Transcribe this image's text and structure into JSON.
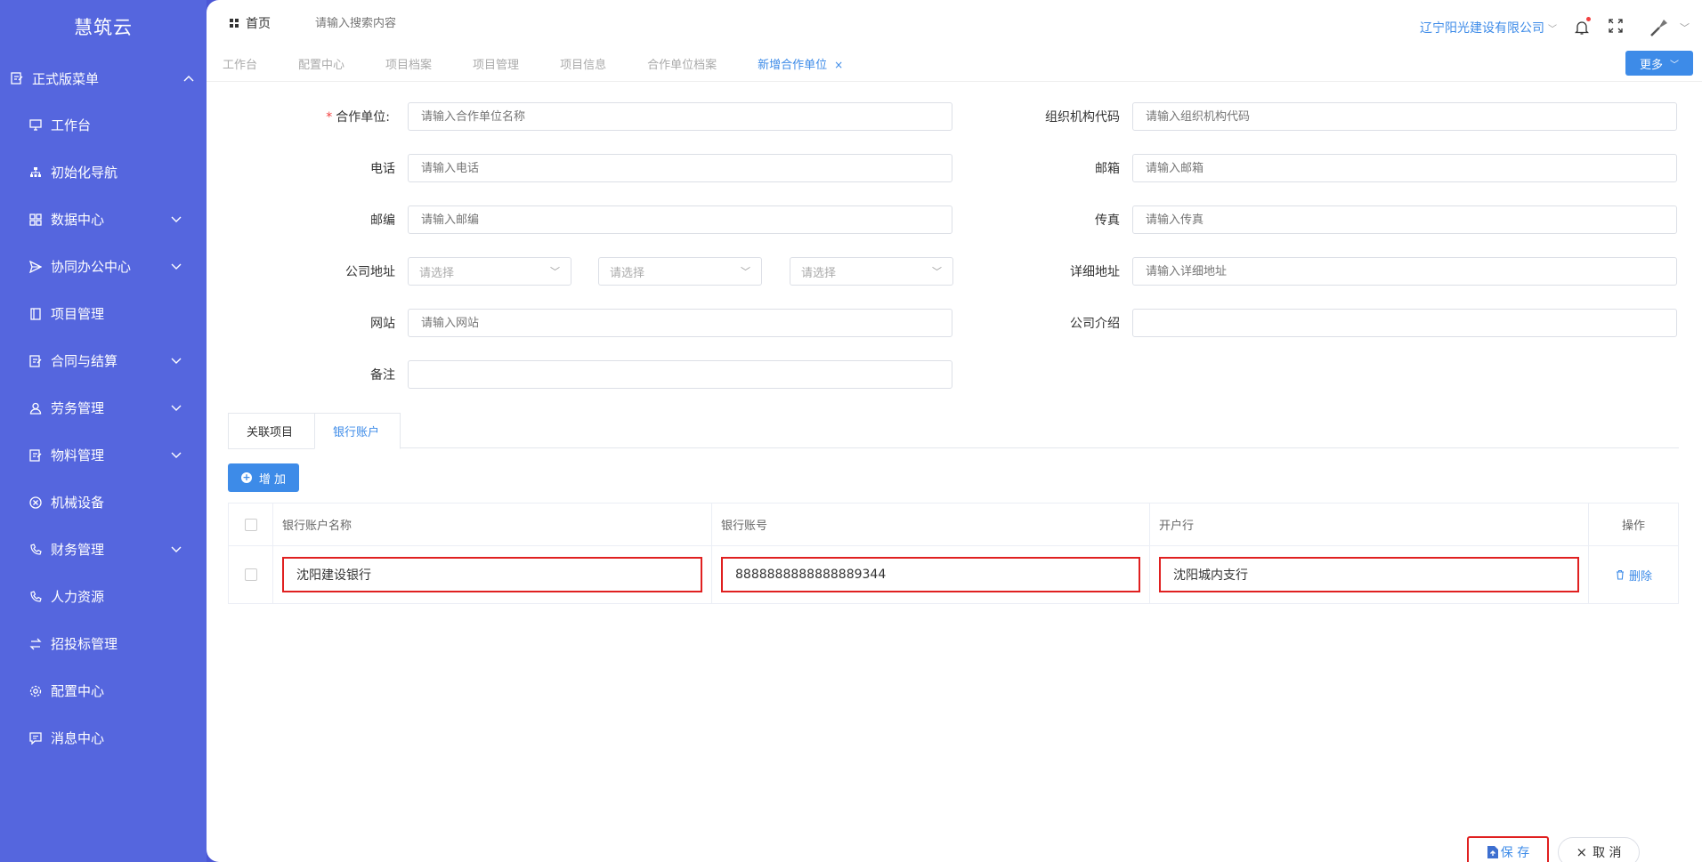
{
  "app": {
    "title": "慧筑云"
  },
  "sidebar": {
    "group": {
      "label": "正式版菜单"
    },
    "items": [
      {
        "label": "工作台",
        "icon": "monitor-icon",
        "has_children": false
      },
      {
        "label": "初始化导航",
        "icon": "sitemap-icon",
        "has_children": false
      },
      {
        "label": "数据中心",
        "icon": "grid-icon",
        "has_children": true
      },
      {
        "label": "协同办公中心",
        "icon": "send-icon",
        "has_children": true
      },
      {
        "label": "项目管理",
        "icon": "book-icon",
        "has_children": false
      },
      {
        "label": "合同与结算",
        "icon": "edit-doc-icon",
        "has_children": true
      },
      {
        "label": "劳务管理",
        "icon": "user-icon",
        "has_children": true
      },
      {
        "label": "物料管理",
        "icon": "edit-doc-icon",
        "has_children": true
      },
      {
        "label": "机械设备",
        "icon": "close-circle-icon",
        "has_children": false
      },
      {
        "label": "财务管理",
        "icon": "phone-icon",
        "has_children": true
      },
      {
        "label": "人力资源",
        "icon": "phone-icon",
        "has_children": false
      },
      {
        "label": "招投标管理",
        "icon": "transfer-icon",
        "has_children": false
      },
      {
        "label": "配置中心",
        "icon": "gear-icon",
        "has_children": false
      },
      {
        "label": "消息中心",
        "icon": "message-icon",
        "has_children": false
      }
    ]
  },
  "topbar": {
    "home_label": "首页",
    "search_placeholder": "请输入搜索内容",
    "company": "辽宁阳光建设有限公司"
  },
  "tabs": [
    {
      "label": "工作台",
      "active": false
    },
    {
      "label": "配置中心",
      "active": false
    },
    {
      "label": "项目档案",
      "active": false
    },
    {
      "label": "项目管理",
      "active": false
    },
    {
      "label": "项目信息",
      "active": false
    },
    {
      "label": "合作单位档案",
      "active": false
    },
    {
      "label": "新增合作单位",
      "active": true
    }
  ],
  "more_label": "更多",
  "form": {
    "partner": {
      "label": "合作单位:",
      "placeholder": "请输入合作单位名称"
    },
    "org_code": {
      "label": "组织机构代码",
      "placeholder": "请输入组织机构代码"
    },
    "phone": {
      "label": "电话",
      "placeholder": "请输入电话"
    },
    "email": {
      "label": "邮箱",
      "placeholder": "请输入邮箱"
    },
    "zipcode": {
      "label": "邮编",
      "placeholder": "请输入邮编"
    },
    "fax": {
      "label": "传真",
      "placeholder": "请输入传真"
    },
    "address": {
      "label": "公司地址",
      "select_placeholder": "请选择"
    },
    "detail_address": {
      "label": "详细地址",
      "placeholder": "请输入详细地址"
    },
    "website": {
      "label": "网站",
      "placeholder": "请输入网站"
    },
    "intro": {
      "label": "公司介绍",
      "value": ""
    },
    "remark": {
      "label": "备注",
      "value": ""
    }
  },
  "subtabs": [
    {
      "label": "关联项目",
      "active": false
    },
    {
      "label": "银行账户",
      "active": true
    }
  ],
  "add_label": "增 加",
  "bank_table": {
    "headers": [
      "银行账户名称",
      "银行账号",
      "开户行",
      "操作"
    ],
    "rows": [
      {
        "name": "沈阳建设银行",
        "account": "8888888888888889344",
        "bank": "沈阳城内支行",
        "action": "删除"
      }
    ]
  },
  "actions": {
    "save": "保 存",
    "cancel": "取 消"
  },
  "colors": {
    "sidebar": "#5566de",
    "accent": "#3d8be8",
    "highlight": "#e02020"
  }
}
